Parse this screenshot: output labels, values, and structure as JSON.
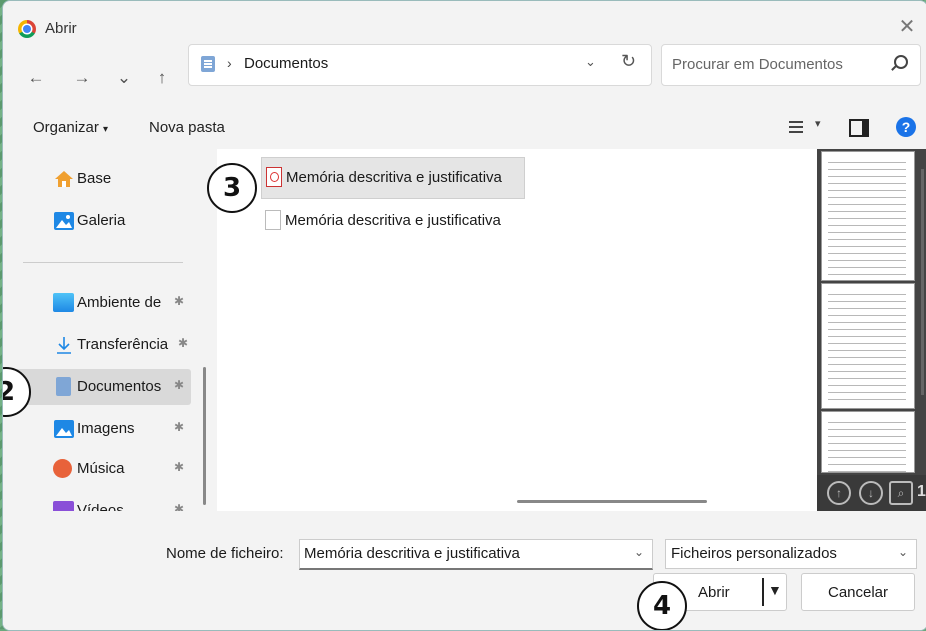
{
  "window": {
    "title": "Abrir"
  },
  "nav": {
    "back": "←",
    "forward": "→",
    "recent": "⌄",
    "up": "↑",
    "address": {
      "separator": "›",
      "path": "Documentos",
      "chevron": "⌄",
      "refresh": "↻"
    },
    "search_placeholder": "Procurar em Documentos"
  },
  "toolbar": {
    "organize": "Organizar",
    "organize_chevron": "▾",
    "new_folder": "Nova pasta",
    "view_chevron": "▾",
    "help": "?"
  },
  "sidebar": {
    "items": [
      {
        "label": "Base",
        "icon": "home-icon",
        "color": "#f0a030"
      },
      {
        "label": "Galeria",
        "icon": "gallery-icon",
        "color": "#1e88e5"
      },
      {
        "label": "Ambiente de",
        "icon": "desktop-icon",
        "color": "#29a9e1",
        "pinned": true
      },
      {
        "label": "Transferência",
        "icon": "download-icon",
        "color": "#1e88e5",
        "pinned": true
      },
      {
        "label": "Documentos",
        "icon": "documents-icon",
        "color": "#7fa6d6",
        "pinned": true,
        "selected": true
      },
      {
        "label": "Imagens",
        "icon": "pictures-icon",
        "color": "#1e88e5",
        "pinned": true
      },
      {
        "label": "Música",
        "icon": "music-icon",
        "color": "#e8623a",
        "pinned": true
      },
      {
        "label": "Vídeos",
        "icon": "videos-icon",
        "color": "#8a4fd8",
        "pinned": true
      }
    ],
    "pin_glyph": "✱"
  },
  "files": [
    {
      "name": "Memória descritiva e justificativa",
      "type": "pdf",
      "selected": true
    },
    {
      "name": "Memória descritiva e justificativa",
      "type": "doc",
      "selected": false
    }
  ],
  "preview": {
    "up": "↑",
    "down": "↓",
    "zoom": "⌕",
    "page": "1"
  },
  "bottom": {
    "filename_label": "Nome de ficheiro:",
    "filename_value": "Memória descritiva e justificativa",
    "dropdown_chevron": "⌄",
    "filetype": "Ficheiros personalizados",
    "open_label": "Abrir",
    "open_arrow": "▼",
    "cancel_label": "Cancelar"
  },
  "steps": {
    "s2": "2",
    "s3": "3",
    "s4": "4"
  }
}
